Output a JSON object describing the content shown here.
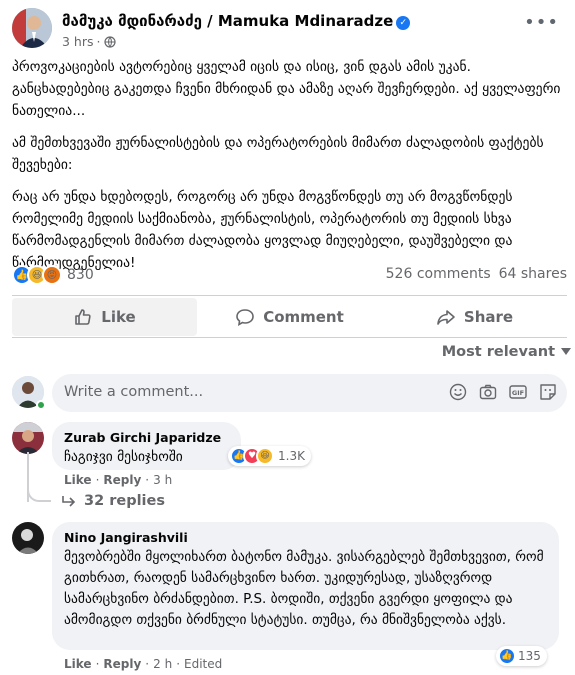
{
  "post": {
    "author": "მამუკა მდინარაძე / Mamuka Mdinaradze",
    "time": "3 hrs",
    "separator": "·",
    "paragraphs": [
      "პროვოკაციების ავტორებიც ყველამ იცის და ისიც, ვინ დგას ამის უკან. განცხადებებიც გაკეთდა ჩვენი მხრიდან და ამაზე აღარ შევჩერდები. აქ ყველაფერი ნათელია...",
      "ამ შემთხვევაში ჟურნალისტების და ოპერატორების მიმართ ძალადობის ფაქტებს შევეხები:",
      "რაც არ უნდა ხდებოდეს, როგორც არ უნდა მოგვწონდეს თუ არ მოგვწონდეს რომელიმე მედიის  საქმიანობა, ჟურნალისტის, ოპერატორის თუ მედიის სხვა წარმომადგენლის მიმართ ძალადობა ყოვლად მიუღებელი, დაუშვებელი და წარმოუდგენელია!"
    ],
    "reaction_count": "830",
    "comments_count": "526 comments",
    "shares_count": "64 shares"
  },
  "actions": {
    "like": "Like",
    "comment": "Comment",
    "share": "Share"
  },
  "sort_label": "Most relevant",
  "write_placeholder": "Write a comment...",
  "comments": [
    {
      "name": "Zurab Girchi Japaridze",
      "text": "ჩაგიჯვი მესიჯხოში",
      "like_label": "Like",
      "reply_label": "Reply",
      "time": "3 h",
      "reaction_count": "1.3K",
      "replies_label": "32 replies"
    },
    {
      "name": "Nino Jangirashvili",
      "text": "მევობრებში მყოლიხართ ბატონო მამუკა. ვისარგებლებ შემთხვევით, რომ გითხრათ, რაოდენ სამარცხვინო ხართ. უკიდურესად, უსაზღვროდ სამარცხვინო ბრძანდებით. P.S. ბოდიში, თქვენი გვერდი ყოფილა და ამომიგდო თქვენი ბრძნული სტატუსი. თუმცა, რა მნიშვნელობა აქვს.",
      "like_label": "Like",
      "reply_label": "Reply",
      "time": "2 h",
      "edited_label": "Edited",
      "reaction_count": "135"
    }
  ],
  "colors": {
    "accent": "#1877f2",
    "secondary_text": "#65676b",
    "bubble": "#f0f2f5"
  }
}
